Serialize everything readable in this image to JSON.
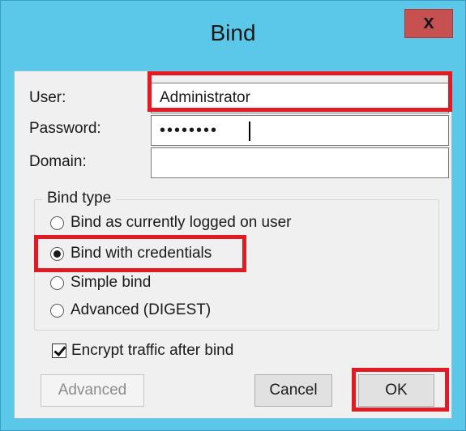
{
  "window": {
    "title": "Bind",
    "close_label": "x"
  },
  "fields": {
    "user_label": "User:",
    "user_value": "Administrator",
    "password_label": "Password:",
    "password_dots": "••••••••",
    "domain_label": "Domain:",
    "domain_value": ""
  },
  "bind_type": {
    "title": "Bind type",
    "options": [
      {
        "label": "Bind as currently logged on user",
        "checked": false
      },
      {
        "label": "Bind with credentials",
        "checked": true
      },
      {
        "label": "Simple bind",
        "checked": false
      },
      {
        "label": "Advanced (DIGEST)",
        "checked": false
      }
    ]
  },
  "encrypt": {
    "label": "Encrypt traffic after bind",
    "checked": true
  },
  "buttons": {
    "advanced": "Advanced",
    "cancel": "Cancel",
    "ok": "OK"
  },
  "colors": {
    "title_bar": "#5bc8ea",
    "highlight": "#e01b24",
    "close_button": "#c75050",
    "client_bg": "#f0f0f0"
  }
}
